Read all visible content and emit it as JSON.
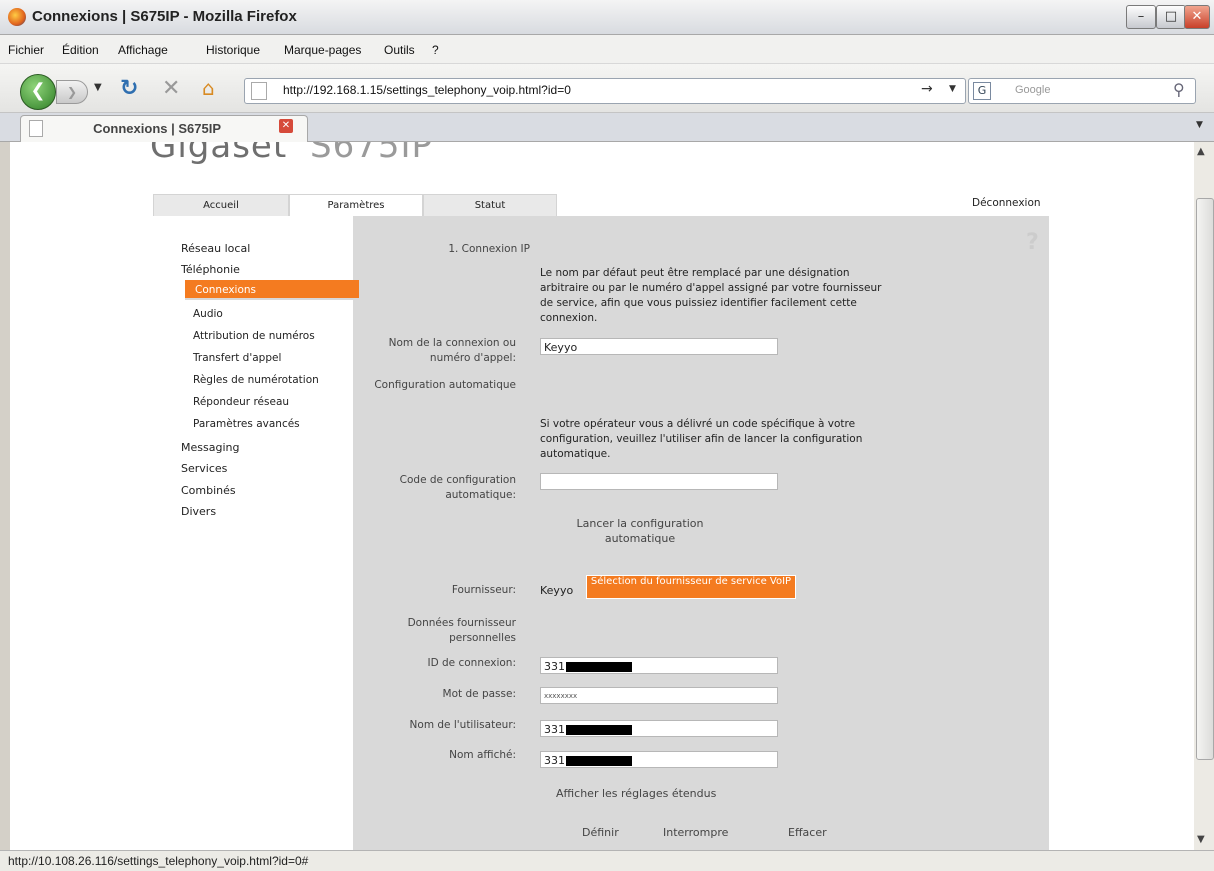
{
  "browser": {
    "window_title": "Connexions | S675IP - Mozilla Firefox",
    "menus": [
      "Fichier",
      "Édition",
      "Affichage",
      "Historique",
      "Marque-pages",
      "Outils",
      "?"
    ],
    "url": "http://192.168.1.15/settings_telephony_voip.html?id=0",
    "search_placeholder": "Google",
    "tab_title": "Connexions | S675IP",
    "status_url": "http://10.108.26.116/settings_telephony_voip.html?id=0#"
  },
  "page": {
    "logo_brand": "Gigaset",
    "logo_model": "S675IP",
    "tabs": [
      "Accueil",
      "Paramètres",
      "Statut"
    ],
    "logout": "Déconnexion",
    "sidebar": {
      "items": [
        "Réseau local",
        "Téléphonie"
      ],
      "telephony_sub": [
        "Connexions",
        "Audio",
        "Attribution de numéros",
        "Transfert d'appel",
        "Règles de numérotation",
        "Répondeur réseau",
        "Paramètres avancés"
      ],
      "items_after": [
        "Messaging",
        "Services",
        "Combinés",
        "Divers"
      ]
    },
    "form": {
      "section_title": "1. Connexion IP",
      "intro": "Le nom par défaut peut être remplacé par une désignation arbitraire ou par le numéro d'appel assigné par votre fournisseur de service, afin que vous puissiez identifier facilement cette connexion.",
      "name_label": "Nom de la connexion ou numéro d'appel:",
      "name_value": "Keyyo",
      "auto_config_title": "Configuration automatique",
      "auto_config_desc": "Si votre opérateur vous a délivré un code spécifique à votre configuration, veuillez l'utiliser afin de lancer la configuration automatique.",
      "auto_code_label": "Code de configuration automatique:",
      "auto_code_value": "",
      "launch_auto": "Lancer la configuration automatique",
      "provider_label": "Fournisseur:",
      "provider_value": "Keyyo",
      "provider_button": "Sélection du fournisseur de service VoIP",
      "personal_title": "Données fournisseur personnelles",
      "login_id_label": "ID de connexion:",
      "login_id_prefix": "331",
      "password_label": "Mot de passe:",
      "password_value": "xxxxxxxx",
      "username_label": "Nom de l'utilisateur:",
      "username_prefix": "331",
      "display_name_label": "Nom affiché:",
      "display_name_prefix": "331",
      "show_advanced": "Afficher les réglages étendus",
      "buttons": [
        "Définir",
        "Interrompre",
        "Effacer"
      ]
    }
  },
  "colors": {
    "accent_orange": "#f47b20",
    "form_bg": "#d9d9d9"
  }
}
